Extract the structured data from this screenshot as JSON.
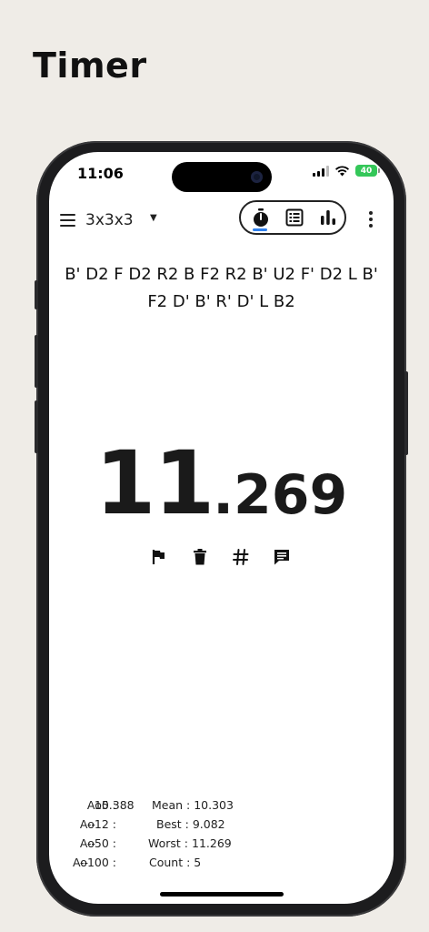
{
  "page_heading": "Timer",
  "status_bar": {
    "time": "11:06",
    "battery": "40"
  },
  "app_bar": {
    "puzzle": "3x3x3",
    "modes": [
      "timer-icon",
      "list-icon",
      "stats-icon"
    ]
  },
  "scramble": "B' D2 F D2 R2 B F2 R2 B' U2 F' D2 L B' F2 D' B' R' D' L B2",
  "timer": {
    "integer": "11",
    "decimal": ".269"
  },
  "actions": [
    "flag-icon",
    "delete-icon",
    "hash-icon",
    "comment-icon"
  ],
  "stats": {
    "ao5_label": "Ao5 :",
    "ao5_value": "10.388",
    "ao12_label": "Ao12 :",
    "ao12_value": "--",
    "ao50_label": "Ao50 :",
    "ao50_value": "--",
    "ao100_label": "Ao100 :",
    "ao100_value": "--",
    "mean": "Mean : 10.303",
    "best": "Best : 9.082",
    "worst": "Worst : 11.269",
    "count": "Count : 5"
  }
}
